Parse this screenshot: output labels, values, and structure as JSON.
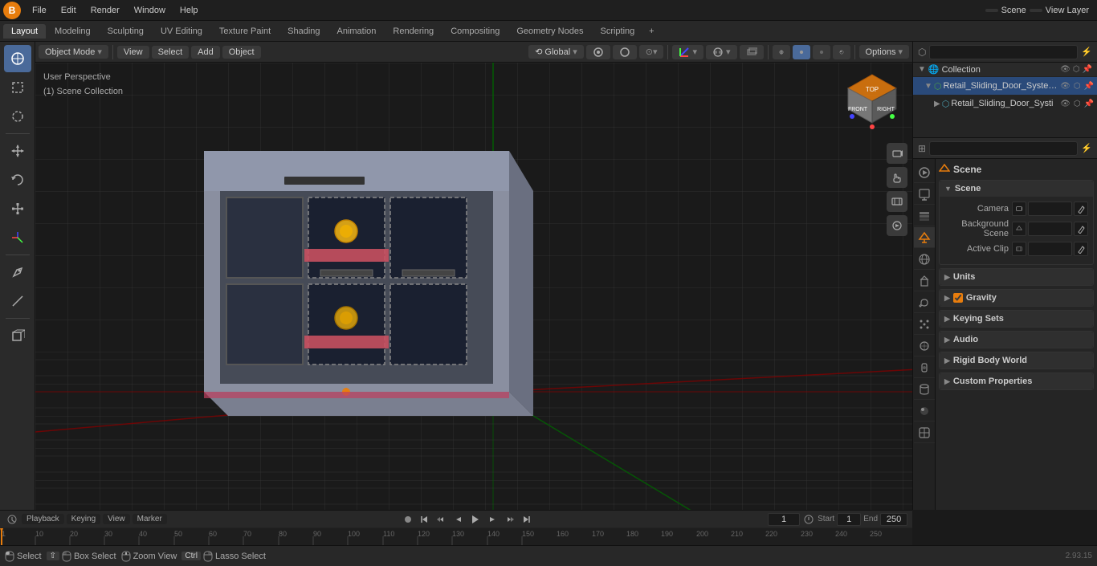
{
  "app": {
    "title": "Blender"
  },
  "menu": {
    "logo": "B",
    "items": [
      {
        "label": "File",
        "id": "file"
      },
      {
        "label": "Edit",
        "id": "edit"
      },
      {
        "label": "Render",
        "id": "render"
      },
      {
        "label": "Window",
        "id": "window"
      },
      {
        "label": "Help",
        "id": "help"
      }
    ]
  },
  "workspace_tabs": [
    {
      "label": "Layout",
      "active": true
    },
    {
      "label": "Modeling"
    },
    {
      "label": "Sculpting"
    },
    {
      "label": "UV Editing"
    },
    {
      "label": "Texture Paint"
    },
    {
      "label": "Shading"
    },
    {
      "label": "Animation"
    },
    {
      "label": "Rendering"
    },
    {
      "label": "Compositing"
    },
    {
      "label": "Geometry Nodes"
    },
    {
      "label": "Scripting"
    }
  ],
  "viewport_header": {
    "mode": "Object Mode",
    "view": "View",
    "select": "Select",
    "add": "Add",
    "object": "Object",
    "transform": "Global",
    "options": "Options"
  },
  "view_info": {
    "line1": "User Perspective",
    "line2": "(1) Scene Collection"
  },
  "outliner": {
    "title": "Scene Collection",
    "search_placeholder": "",
    "items": [
      {
        "label": "Retail_Sliding_Door_System_",
        "indent": 0,
        "expanded": true,
        "icon": "▼",
        "type_icon": "⬡"
      },
      {
        "label": "Retail_Sliding_Door_Systi",
        "indent": 1,
        "expanded": false,
        "icon": "▶",
        "type_icon": "⬡"
      }
    ]
  },
  "properties": {
    "scene_title": "Scene",
    "tabs": [
      {
        "icon": "🎬",
        "label": "render",
        "active": false
      },
      {
        "icon": "📤",
        "label": "output",
        "active": false
      },
      {
        "icon": "👁",
        "label": "view-layer",
        "active": false
      },
      {
        "icon": "🌐",
        "label": "scene",
        "active": true
      },
      {
        "icon": "🌍",
        "label": "world",
        "active": false
      },
      {
        "icon": "📦",
        "label": "object",
        "active": false
      },
      {
        "icon": "⬡",
        "label": "modifier",
        "active": false
      },
      {
        "icon": "⬜",
        "label": "particles",
        "active": false
      },
      {
        "icon": "⚙",
        "label": "physics",
        "active": false
      },
      {
        "icon": "🔒",
        "label": "constraints",
        "active": false
      },
      {
        "icon": "📊",
        "label": "data",
        "active": false
      },
      {
        "icon": "🎨",
        "label": "material",
        "active": false
      },
      {
        "icon": "🔲",
        "label": "shader",
        "active": false
      }
    ],
    "collection_label": "Collection",
    "sections": {
      "scene": {
        "title": "Scene",
        "expanded": true,
        "camera_label": "Camera",
        "camera_value": "",
        "background_scene_label": "Background Scene",
        "background_scene_value": "",
        "active_clip_label": "Active Clip",
        "active_clip_value": ""
      },
      "units": {
        "title": "Units",
        "expanded": false
      },
      "gravity": {
        "title": "Gravity",
        "expanded": false,
        "checked": true
      },
      "keying_sets": {
        "title": "Keying Sets",
        "expanded": false
      },
      "audio": {
        "title": "Audio",
        "expanded": false
      },
      "rigid_body_world": {
        "title": "Rigid Body World",
        "expanded": false
      },
      "custom_properties": {
        "title": "Custom Properties",
        "expanded": false
      }
    }
  },
  "playback": {
    "playback_label": "Playback",
    "keying_label": "Keying",
    "view_label": "View",
    "marker_label": "Marker",
    "current_frame": "1",
    "start_label": "Start",
    "start_value": "1",
    "end_label": "End",
    "end_value": "250"
  },
  "timeline_ticks": [
    {
      "value": "1",
      "pos": 0
    },
    {
      "value": "10",
      "pos": 43
    },
    {
      "value": "20",
      "pos": 87
    },
    {
      "value": "30",
      "pos": 130
    },
    {
      "value": "40",
      "pos": 173
    },
    {
      "value": "50",
      "pos": 217
    },
    {
      "value": "60",
      "pos": 260
    },
    {
      "value": "70",
      "pos": 303
    },
    {
      "value": "80",
      "pos": 347
    },
    {
      "value": "90",
      "pos": 390
    },
    {
      "value": "100",
      "pos": 433
    },
    {
      "value": "110",
      "pos": 477
    },
    {
      "value": "120",
      "pos": 520
    },
    {
      "value": "130",
      "pos": 563
    },
    {
      "value": "140",
      "pos": 607
    },
    {
      "value": "150",
      "pos": 650
    },
    {
      "value": "160",
      "pos": 693
    },
    {
      "value": "170",
      "pos": 737
    },
    {
      "value": "180",
      "pos": 780
    },
    {
      "value": "190",
      "pos": 823
    },
    {
      "value": "200",
      "pos": 867
    },
    {
      "value": "210",
      "pos": 910
    },
    {
      "value": "220",
      "pos": 953
    },
    {
      "value": "230",
      "pos": 997
    },
    {
      "value": "240",
      "pos": 1040
    },
    {
      "value": "250",
      "pos": 1083
    }
  ],
  "status_bar": {
    "select_label": "Select",
    "box_select_label": "Box Select",
    "zoom_view_label": "Zoom View",
    "lasso_select_label": "Lasso Select",
    "version": "2.93.15"
  },
  "colors": {
    "accent": "#e87d0d",
    "active_blue": "#4a6a9a",
    "bg_dark": "#1a1a1a",
    "bg_medium": "#252525",
    "bg_light": "#2a2a2a",
    "border": "#111",
    "text": "#ccc",
    "text_dim": "#888"
  }
}
